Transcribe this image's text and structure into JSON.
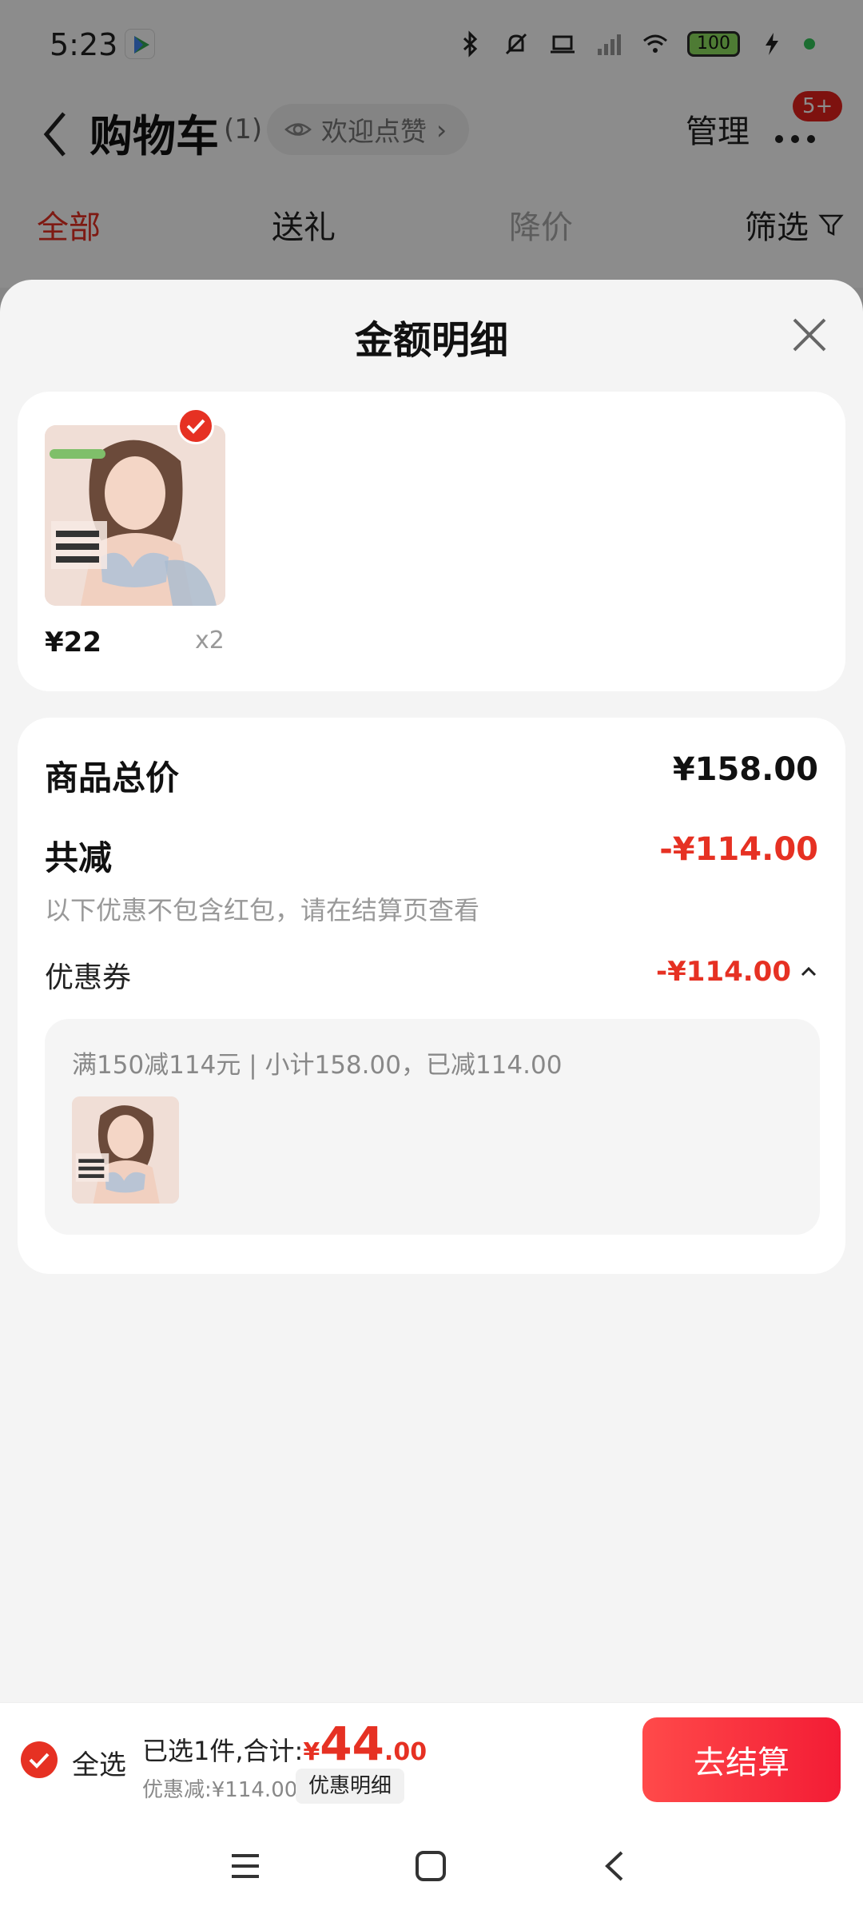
{
  "status_bar": {
    "time": "5:23",
    "battery": "100"
  },
  "header": {
    "title": "购物车",
    "count": "(1)",
    "like_label": "欢迎点赞",
    "manage_label": "管理",
    "badge": "5+"
  },
  "filters": {
    "all": "全部",
    "gift": "送礼",
    "price_drop": "降价",
    "filter": "筛选"
  },
  "sheet": {
    "title": "金额明细",
    "product": {
      "price": "¥22",
      "qty": "x2"
    },
    "total_label": "商品总价",
    "total_value": "¥158.00",
    "reduction_label": "共减",
    "reduction_value": "-¥114.00",
    "note": "以下优惠不包含红包，请在结算页查看",
    "coupon_label": "优惠券",
    "coupon_value": "-¥114.00",
    "coupon_text": "满150减114元 | 小计158.00，已减114.00"
  },
  "bottom_bar": {
    "select_all": "全选",
    "summary_prefix": "已选1件,合计:",
    "currency": "¥",
    "amount_int": "44",
    "amount_dec": ".00",
    "discount": "优惠减:¥114.00",
    "detail_button": "优惠明细",
    "checkout_button": "去结算"
  },
  "colors": {
    "accent": "#e63123",
    "checkout": "#f31c35"
  },
  "icons": [
    "back-icon",
    "eye-icon",
    "more-icon",
    "filter-icon",
    "close-icon",
    "check-icon",
    "chevron-up-icon",
    "menu-icon",
    "home-icon",
    "nav-back-icon"
  ]
}
